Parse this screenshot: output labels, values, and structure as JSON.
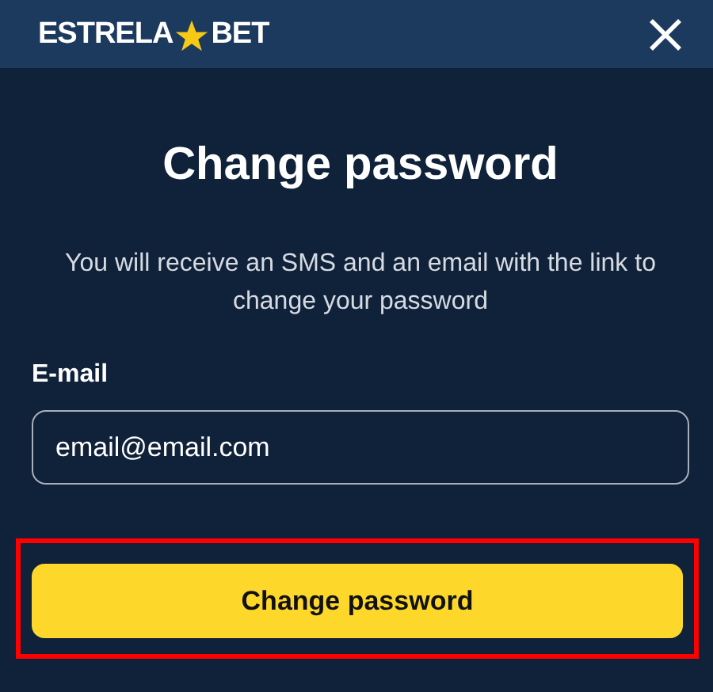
{
  "header": {
    "logo_left": "ESTRELA",
    "logo_right": "BET"
  },
  "title": "Change password",
  "description": "You will receive an SMS and an email with the link to change your password",
  "email_field": {
    "label": "E-mail",
    "value": "email@email.com",
    "focused": true
  },
  "submit_button": {
    "label": "Change password",
    "highlighted": true
  }
}
